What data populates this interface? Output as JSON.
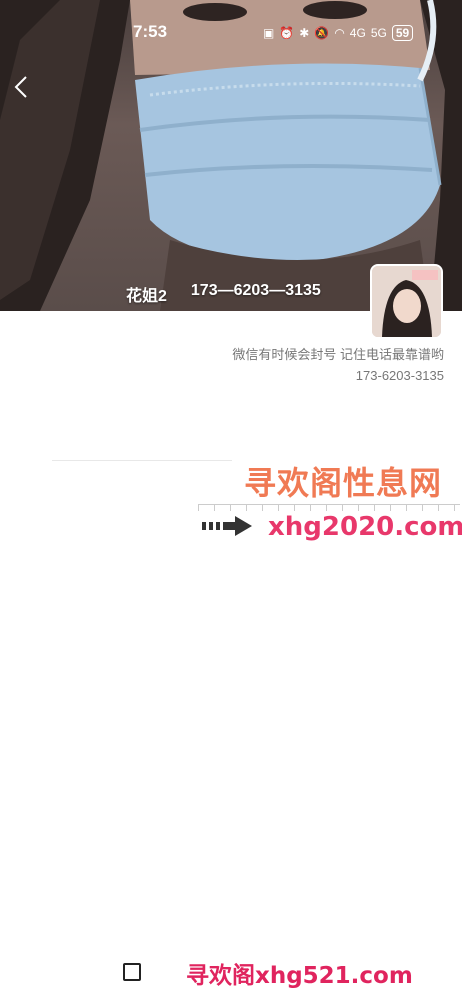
{
  "status_bar": {
    "time": "7:53",
    "icons": [
      "nfc-icon",
      "alarm-icon",
      "bluetooth-icon",
      "mute-icon",
      "wifi-icon",
      "4g-signal-icon",
      "5g-signal-icon"
    ],
    "signal_4g": "4G",
    "signal_5g": "5G",
    "battery": "59"
  },
  "profile": {
    "name": "花姐2",
    "phone": "173—6203—3135",
    "signature_line1": "微信有时候会封号  记住电话最靠谱哟",
    "signature_line2": "173-6203-3135"
  },
  "watermark": {
    "title": "寻欢阁性息网",
    "url": "xhg2020.com",
    "footer": "寻欢阁xhg521.com"
  },
  "colors": {
    "watermark_title": "#f07a54",
    "watermark_url": "#e8386b",
    "footer": "#e0245e"
  }
}
